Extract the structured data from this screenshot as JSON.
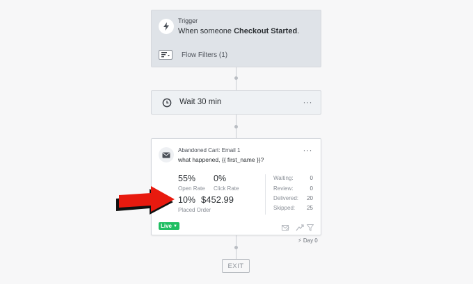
{
  "trigger": {
    "title": "Trigger",
    "desc_prefix": "When someone ",
    "desc_event": "Checkout Started",
    "desc_suffix": ".",
    "icon": "lightning-icon",
    "filters_label": "Flow Filters (1)"
  },
  "wait": {
    "label": "Wait 30 min",
    "icon": "clock-icon",
    "menu": "···"
  },
  "email": {
    "title": "Abandoned Cart: Email 1",
    "subject": "what happened, {{ first_name }}?",
    "icon": "envelope-icon",
    "menu": "···",
    "stats": {
      "open_rate_value": "55%",
      "open_rate_label": "Open Rate",
      "click_rate_value": "0%",
      "click_rate_label": "Click Rate",
      "placed_order_pct": "10%",
      "placed_order_value": "$452.99",
      "placed_order_label": "Placed Order"
    },
    "counts": [
      {
        "label": "Waiting:",
        "value": "0"
      },
      {
        "label": "Review:",
        "value": "0"
      },
      {
        "label": "Delivered:",
        "value": "20"
      },
      {
        "label": "Skipped:",
        "value": "25"
      }
    ],
    "status_badge": "Live",
    "day_label": "Day 0"
  },
  "exit": {
    "label": "EXIT"
  },
  "colors": {
    "live_green": "#1fbe62",
    "arrow_red": "#e81a0f"
  }
}
